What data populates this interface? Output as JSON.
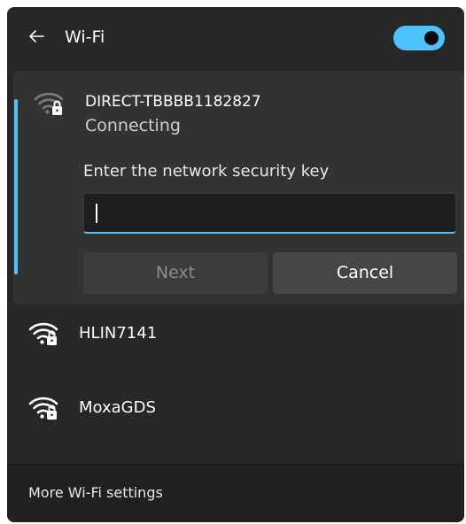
{
  "header": {
    "title": "Wi-Fi",
    "back_icon": "back-arrow-icon",
    "toggle_state": "on",
    "accent_color": "#4cc2ff"
  },
  "connecting_network": {
    "name": "DIRECT-TBBBB1182827",
    "status": "Connecting",
    "icon": "wifi-secured-icon",
    "key_prompt": "Enter the network security key",
    "key_value": "",
    "next_label": "Next",
    "cancel_label": "Cancel"
  },
  "networks": [
    {
      "name": "HLIN7141",
      "icon": "wifi-secured-icon"
    },
    {
      "name": "MoxaGDS",
      "icon": "wifi-secured-icon"
    }
  ],
  "footer": {
    "link_label": "More Wi-Fi settings"
  }
}
